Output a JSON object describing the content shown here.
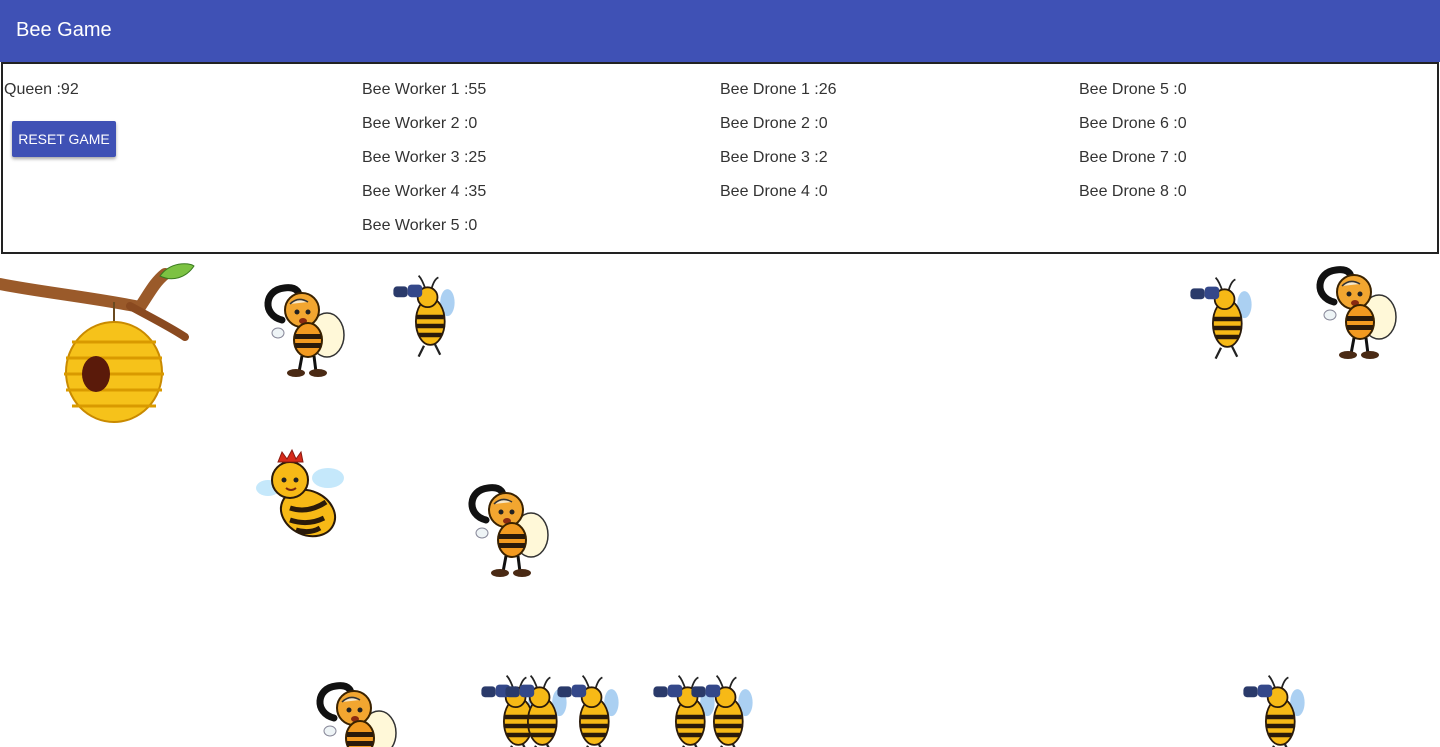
{
  "app": {
    "title": "Bee Game"
  },
  "queen": {
    "label": "Queen :92"
  },
  "reset_button": {
    "label": "RESET GAME"
  },
  "workers": [
    "Bee Worker 1 :55",
    "Bee Worker 2 :0",
    "Bee Worker 3 :25",
    "Bee Worker 4 :35",
    "Bee Worker 5 :0"
  ],
  "drones_a": [
    "Bee Drone 1 :26",
    "Bee Drone 2 :0",
    "Bee Drone 3 :2",
    "Bee Drone 4 :0"
  ],
  "drones_b": [
    "Bee Drone 5 :0",
    "Bee Drone 6 :0",
    "Bee Drone 7 :0",
    "Bee Drone 8 :0"
  ],
  "colors": {
    "appbar": "#3f51b5",
    "bee_yellow": "#f7b916",
    "bee_stripe": "#2a1a0a"
  },
  "icons": [
    "beehive-branch-icon",
    "queen-bee-icon",
    "worker-bee-icon",
    "drone-bee-binoculars-icon"
  ]
}
